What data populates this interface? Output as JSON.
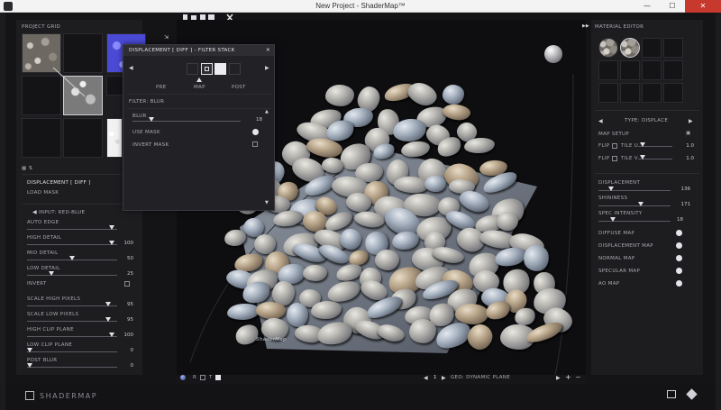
{
  "window": {
    "title": "New Project - ShaderMap™",
    "minimize": "—",
    "maximize": "☐",
    "close": "✕"
  },
  "toolbar": {
    "icons": [
      "new-file-icon",
      "open-folder-icon",
      "save-icon",
      "save-all-icon",
      "tools-icon"
    ]
  },
  "project_grid": {
    "label_light": "PROJECT",
    "label_bold": "GRID"
  },
  "left_panel": {
    "map_name": "DISPLACEMENT [ DIFF ]",
    "load_mask": "LOAD MASK",
    "input_prefix": "INPUT:",
    "input_value": "RED-BLUE",
    "rows": [
      {
        "label": "AUTO EDGE",
        "value": "",
        "thumb": 0.97
      },
      {
        "label": "HIGH DETAIL",
        "value": "100",
        "thumb": 0.97
      },
      {
        "label": "MID DETAIL",
        "value": "50",
        "thumb": 0.5
      },
      {
        "label": "LOW DETAIL",
        "value": "25",
        "thumb": 0.25
      },
      {
        "label": "INVERT",
        "value": "",
        "checkbox": true
      },
      {
        "label": "SCALE HIGH PIXELS",
        "value": "95",
        "thumb": 0.93
      },
      {
        "label": "SCALE LOW PIXELS",
        "value": "95",
        "thumb": 0.93
      },
      {
        "label": "HIGH CLIP PLANE",
        "value": "100",
        "thumb": 0.97
      },
      {
        "label": "LOW CLIP PLANE",
        "value": "0",
        "thumb": 0.0
      },
      {
        "label": "POST BLUR",
        "value": "0",
        "thumb": 0.0
      }
    ]
  },
  "filter_dialog": {
    "title": "DISPLACEMENT [ DIFF ] - FILTER STACK",
    "close": "✕",
    "tabs": [
      "PRE",
      "MAP",
      "POST"
    ],
    "filter_prefix": "FILTER:",
    "filter_name": "BLUR",
    "blur_label": "BLUR",
    "blur_value": "18",
    "blur_thumb": 0.16,
    "use_mask": "USE MASK",
    "invert_mask": "INVERT MASK"
  },
  "right_panel": {
    "header_light": "MATERIAL",
    "header_bold": "EDITOR",
    "type_label": "TYPE:",
    "type_value": "DISPLACE",
    "map_setup": "MAP SETUP",
    "flip_u": "FLIP",
    "tile_u": "TILE U",
    "tile_u_value": "1.0",
    "flip_v": "FLIP",
    "tile_v": "TILE V",
    "tile_v_value": "1.0",
    "displacement": "DISPLACEMENT",
    "displacement_value": "136",
    "shininess": "SHININESS",
    "shininess_value": "171",
    "spec_intensity": "SPEC INTENSITY",
    "spec_intensity_value": "18",
    "maps": [
      "DIFFUSE MAP",
      "DISPLACEMENT MAP",
      "NORMAL MAP",
      "SPECULAR MAP",
      "AO MAP"
    ]
  },
  "viewport": {
    "page_value": "1",
    "geo_label": "GEO:",
    "geo_value": "DYNAMIC PLANE",
    "view_buttons": [
      "R",
      "T"
    ],
    "watermark": "ShaderMap"
  },
  "footer": {
    "brand": "SHADERMAP"
  }
}
